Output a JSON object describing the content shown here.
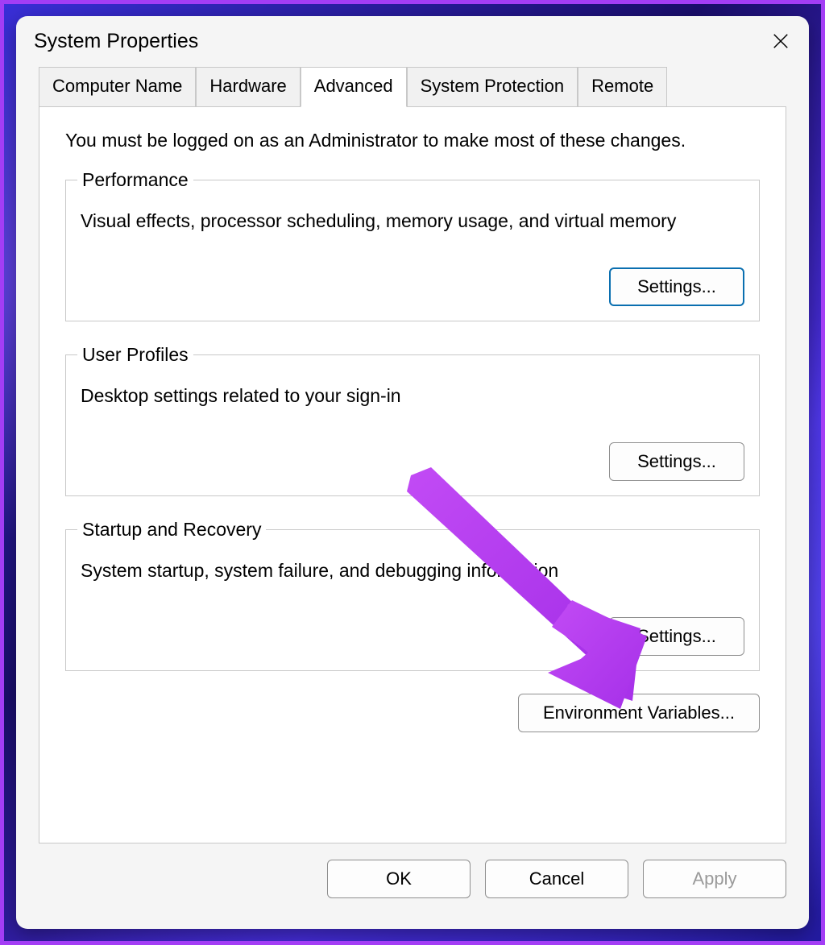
{
  "window": {
    "title": "System Properties"
  },
  "tabs": {
    "computer_name": "Computer Name",
    "hardware": "Hardware",
    "advanced": "Advanced",
    "system_protection": "System Protection",
    "remote": "Remote"
  },
  "advanced_panel": {
    "intro": "You must be logged on as an Administrator to make most of these changes.",
    "performance": {
      "legend": "Performance",
      "desc": "Visual effects, processor scheduling, memory usage, and virtual memory",
      "button": "Settings..."
    },
    "user_profiles": {
      "legend": "User Profiles",
      "desc": "Desktop settings related to your sign-in",
      "button": "Settings..."
    },
    "startup_recovery": {
      "legend": "Startup and Recovery",
      "desc": "System startup, system failure, and debugging information",
      "button": "Settings..."
    },
    "env_vars_button": "Environment Variables..."
  },
  "footer": {
    "ok": "OK",
    "cancel": "Cancel",
    "apply": "Apply"
  },
  "annotation": {
    "arrow_color": "#b53bf0"
  }
}
